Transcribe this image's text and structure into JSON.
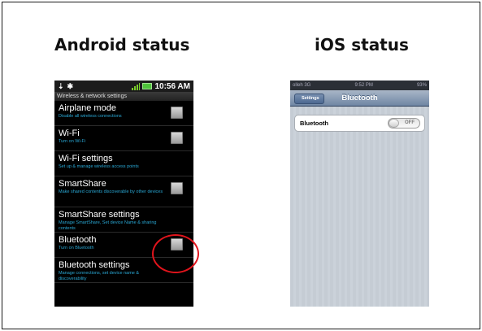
{
  "headings": {
    "android": "Android status",
    "ios": "iOS status"
  },
  "android": {
    "status_bar": {
      "time": "10:56 AM",
      "left_icons": [
        "usb-icon",
        "android-icon"
      ]
    },
    "subheader": "Wireless & network settings",
    "rows": [
      {
        "title": "Airplane mode",
        "subtitle": "Disable all wireless connections",
        "checkbox": true
      },
      {
        "title": "Wi-Fi",
        "subtitle": "Turn on Wi-Fi",
        "checkbox": true
      },
      {
        "title": "Wi-Fi settings",
        "subtitle": "Set up & manage wireless access points",
        "checkbox": false
      },
      {
        "title": "SmartShare",
        "subtitle": "Make shared contents discoverable by other devices",
        "checkbox": true
      },
      {
        "title": "SmartShare settings",
        "subtitle": "Manage SmartShare, Set device Name & sharing contents",
        "checkbox": false
      },
      {
        "title": "Bluetooth",
        "subtitle": "Turn on Bluetooth",
        "checkbox": true
      },
      {
        "title": "Bluetooth settings",
        "subtitle": "Manage connections, set device name & discoverability",
        "checkbox": false
      }
    ],
    "highlight_color": "#e0141c"
  },
  "ios": {
    "status_bar": {
      "carrier": "olleh 3G",
      "time": "9:52 PM",
      "battery": "93%"
    },
    "nav": {
      "back_label": "Settings",
      "title": "Bluetooth"
    },
    "cell": {
      "label": "Bluetooth",
      "toggle": "OFF"
    }
  }
}
